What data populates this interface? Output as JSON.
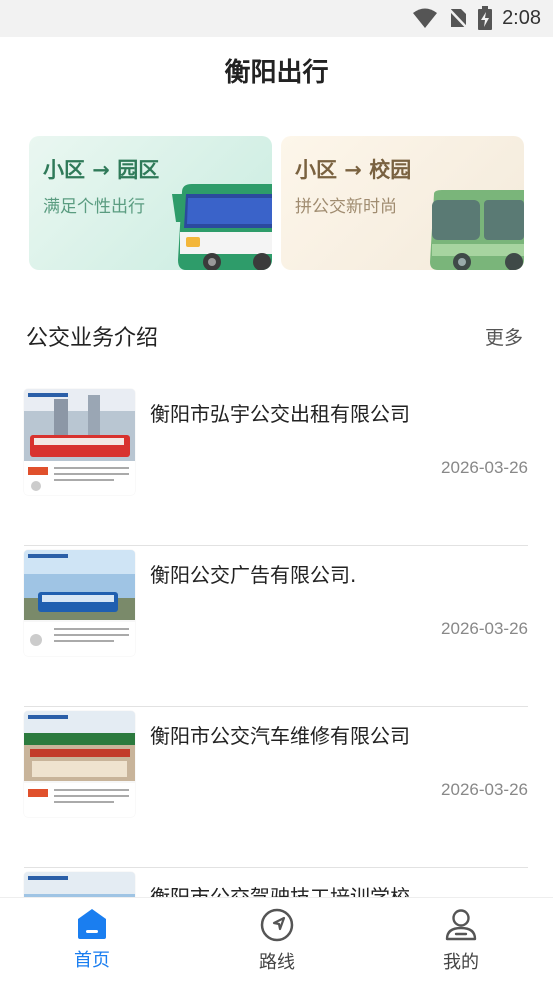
{
  "status_bar": {
    "time": "2:08",
    "icons": [
      "wifi-icon",
      "no-sim-icon",
      "battery-charging-icon"
    ]
  },
  "header": {
    "title": "衡阳出行"
  },
  "cards": [
    {
      "title": "小区 → 园区",
      "subtitle": "满足个性出行",
      "accent": "#2f7a59",
      "bus_color": "#2e9c6a"
    },
    {
      "title": "小区 → 校园",
      "subtitle": "拼公交新时尚",
      "accent": "#7a6240",
      "bus_color": "#6aa870"
    }
  ],
  "section": {
    "title": "公交业务介绍",
    "more_label": "更多"
  },
  "news": [
    {
      "title": "衡阳市弘宇公交出租有限公司",
      "date": "2026-03-26",
      "thumb_color": "#d8322e"
    },
    {
      "title": "衡阳公交广告有限公司.",
      "date": "2026-03-26",
      "thumb_color": "#1f5fb0"
    },
    {
      "title": "衡阳市公交汽车维修有限公司",
      "date": "2026-03-26",
      "thumb_color": "#c23a2a"
    },
    {
      "title": "衡阳市公交驾驶技工培训学校",
      "date": "",
      "thumb_color": "#3a7fbe"
    }
  ],
  "bottom_nav": [
    {
      "label": "首页",
      "icon": "home-icon",
      "active": true
    },
    {
      "label": "路线",
      "icon": "navigation-icon",
      "active": false
    },
    {
      "label": "我的",
      "icon": "user-icon",
      "active": false
    }
  ],
  "colors": {
    "primary": "#1a7ef0"
  }
}
